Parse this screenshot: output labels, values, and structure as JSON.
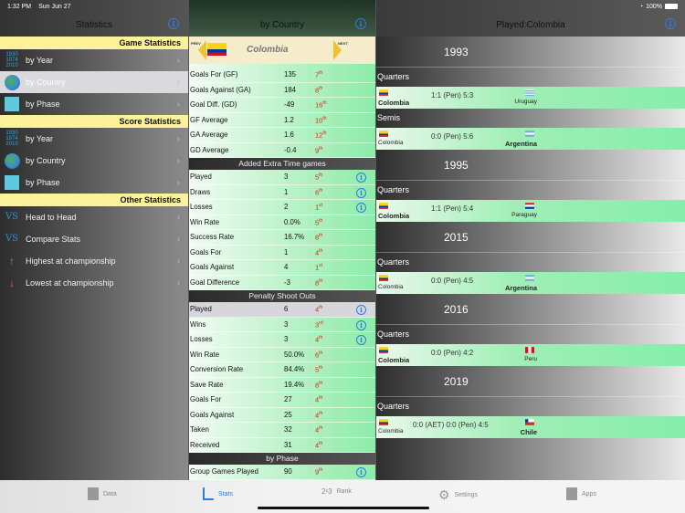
{
  "status_bar": {
    "time": "1:32 PM",
    "date": "Sun Jun 27",
    "battery": "100%"
  },
  "left_pane": {
    "title": "Statistics",
    "sections": [
      {
        "header": "Game Statistics",
        "items": [
          {
            "label": "by Year",
            "icon": "years-icon",
            "selected": false
          },
          {
            "label": "by Country",
            "icon": "globe-icon",
            "selected": true
          },
          {
            "label": "by Phase",
            "icon": "phase-icon",
            "selected": false
          }
        ]
      },
      {
        "header": "Score Statistics",
        "items": [
          {
            "label": "by Year",
            "icon": "years-icon",
            "selected": false
          },
          {
            "label": "by Country",
            "icon": "globe-icon",
            "selected": false
          },
          {
            "label": "by Phase",
            "icon": "phase-icon",
            "selected": false
          }
        ]
      },
      {
        "header": "Other Statistics",
        "items": [
          {
            "label": "Head to Head",
            "icon": "vs-icon",
            "selected": false
          },
          {
            "label": "Compare Stats",
            "icon": "vs-icon",
            "selected": false
          },
          {
            "label": "Highest at championship",
            "icon": "highest-icon",
            "selected": false
          },
          {
            "label": "Lowest at championship",
            "icon": "lowest-icon",
            "selected": false
          }
        ]
      }
    ],
    "year_icon_text": [
      "1930",
      "1974",
      "2010"
    ],
    "vs_text": "VS"
  },
  "middle_pane": {
    "title": "by Country",
    "prev_label": "PREV",
    "next_label": "NEXT",
    "country": "Colombia",
    "general": [
      {
        "label": "Goals For (GF)",
        "value": "135",
        "rank": "7",
        "suffix": "th"
      },
      {
        "label": "Goals Against (GA)",
        "value": "184",
        "rank": "8",
        "suffix": "th"
      },
      {
        "label": "Goal Diff. (GD)",
        "value": "-49",
        "rank": "16",
        "suffix": "th"
      },
      {
        "label": "GF Average",
        "value": "1.2",
        "rank": "10",
        "suffix": "th"
      },
      {
        "label": "GA Average",
        "value": "1.6",
        "rank": "12",
        "suffix": "th"
      },
      {
        "label": "GD Average",
        "value": "-0.4",
        "rank": "9",
        "suffix": "th"
      }
    ],
    "extra_time_header": "Added Extra Time games",
    "extra_time": [
      {
        "label": "Played",
        "value": "3",
        "rank": "5",
        "suffix": "th",
        "info": true
      },
      {
        "label": "Draws",
        "value": "1",
        "rank": "6",
        "suffix": "th",
        "info": true
      },
      {
        "label": "Losses",
        "value": "2",
        "rank": "1",
        "suffix": "st",
        "info": true
      },
      {
        "label": "Win Rate",
        "value": "0.0%",
        "rank": "5",
        "suffix": "th",
        "info": false
      },
      {
        "label": "Success Rate",
        "value": "16.7%",
        "rank": "8",
        "suffix": "th",
        "info": false
      },
      {
        "label": "Goals For",
        "value": "1",
        "rank": "4",
        "suffix": "th",
        "info": false
      },
      {
        "label": "Goals Against",
        "value": "4",
        "rank": "1",
        "suffix": "st",
        "info": false
      },
      {
        "label": "Goal Difference",
        "value": "-3",
        "rank": "8",
        "suffix": "th",
        "info": false
      }
    ],
    "penalty_header": "Penalty Shoot Outs",
    "penalty": [
      {
        "label": "Played",
        "value": "6",
        "rank": "4",
        "suffix": "th",
        "info": true,
        "selected": true
      },
      {
        "label": "Wins",
        "value": "3",
        "rank": "3",
        "suffix": "rd",
        "info": true
      },
      {
        "label": "Losses",
        "value": "3",
        "rank": "4",
        "suffix": "th",
        "info": true
      },
      {
        "label": "Win Rate",
        "value": "50.0%",
        "rank": "6",
        "suffix": "th",
        "info": false
      },
      {
        "label": "Conversion Rate",
        "value": "84.4%",
        "rank": "5",
        "suffix": "th",
        "info": false
      },
      {
        "label": "Save Rate",
        "value": "19.4%",
        "rank": "8",
        "suffix": "th",
        "info": false
      },
      {
        "label": "Goals For",
        "value": "27",
        "rank": "4",
        "suffix": "th",
        "info": false
      },
      {
        "label": "Goals Against",
        "value": "25",
        "rank": "4",
        "suffix": "th",
        "info": false
      },
      {
        "label": "Taken",
        "value": "32",
        "rank": "4",
        "suffix": "th",
        "info": false
      },
      {
        "label": "Received",
        "value": "31",
        "rank": "4",
        "suffix": "th",
        "info": false
      }
    ],
    "phase_header": "by Phase",
    "phase": [
      {
        "label": "Group Games Played",
        "value": "90",
        "rank": "9",
        "suffix": "th",
        "info": true
      }
    ]
  },
  "right_pane": {
    "title": "Played:Colombia",
    "years": [
      {
        "year": "1993",
        "matches": [
          {
            "phase": "Quarters",
            "home": "Colombia",
            "away": "Uruguay",
            "score": "1:1  (Pen) 5:3",
            "winner": "home",
            "away_flag": "uruguay"
          },
          {
            "phase": "Semis",
            "home": "Colombia",
            "away": "Argentina",
            "score": "0:0  (Pen) 5:6",
            "winner": "away",
            "away_flag": "argentina"
          }
        ]
      },
      {
        "year": "1995",
        "matches": [
          {
            "phase": "Quarters",
            "home": "Colombia",
            "away": "Paraguay",
            "score": "1:1  (Pen) 5:4",
            "winner": "home",
            "away_flag": "paraguay"
          }
        ]
      },
      {
        "year": "2015",
        "matches": [
          {
            "phase": "Quarters",
            "home": "Colombia",
            "away": "Argentina",
            "score": "0:0  (Pen) 4:5",
            "winner": "away",
            "away_flag": "argentina"
          }
        ]
      },
      {
        "year": "2016",
        "matches": [
          {
            "phase": "Quarters",
            "home": "Colombia",
            "away": "Peru",
            "score": "0:0  (Pen) 4:2",
            "winner": "home",
            "away_flag": "peru"
          }
        ]
      },
      {
        "year": "2019",
        "matches": [
          {
            "phase": "Quarters",
            "home": "Colombia",
            "away": "Chile",
            "score": "0:0  (AET) 0:0  (Pen) 4:5",
            "winner": "away",
            "away_flag": "chile"
          }
        ]
      }
    ]
  },
  "tab_bar": {
    "tabs": [
      {
        "label": "Data",
        "icon": "book-icon",
        "active": false
      },
      {
        "label": "Stats",
        "icon": "stats-icon",
        "active": true
      },
      {
        "label": "Rank",
        "icon": "rank-icon",
        "active": false
      },
      {
        "label": "Settings",
        "icon": "gear-icon",
        "active": false
      },
      {
        "label": "Apps",
        "icon": "apps-icon",
        "active": false
      }
    ],
    "rank_icon_text": "2¹3"
  },
  "colors": {
    "accent": "#2e7be0",
    "rank_red": "#dd2222",
    "section_yellow": "#fbf29a",
    "row_green": "#8cecaa"
  }
}
